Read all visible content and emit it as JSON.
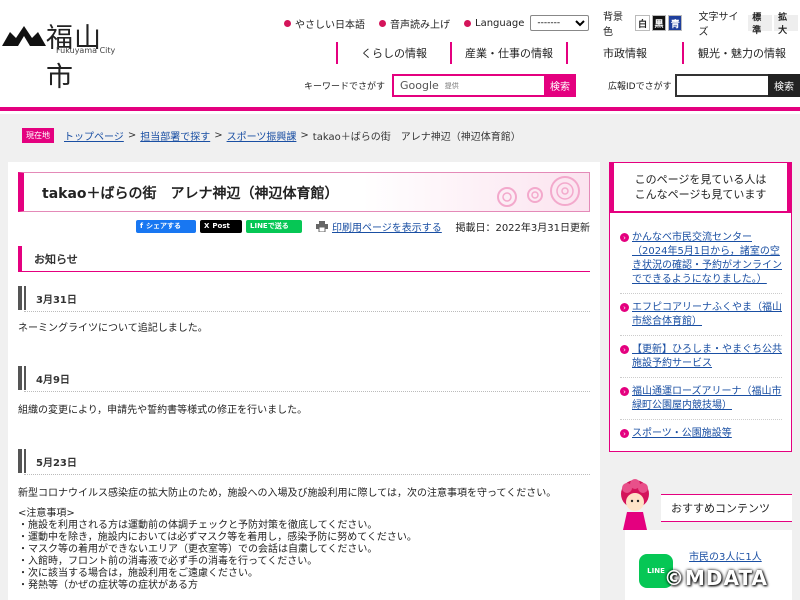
{
  "logo": {
    "kanji": "福山市",
    "english": "Fukuyama City"
  },
  "utility": {
    "easy_japanese": "やさしい日本語",
    "read_aloud": "音声読み上げ",
    "language_label": "Language",
    "language_value": "-------",
    "bg_label": "背景色",
    "bg_white": "白",
    "bg_black": "黒",
    "bg_blue": "青",
    "font_label": "文字サイズ",
    "font_standard": "標準",
    "font_large": "拡大"
  },
  "gnav": [
    {
      "label": "くらしの情報"
    },
    {
      "label": "産業・仕事の情報"
    },
    {
      "label": "市政情報"
    },
    {
      "label": "観光・魅力の情報"
    }
  ],
  "search": {
    "keyword_label": "キーワードでさがす",
    "google": "Google",
    "provided": "提供",
    "keyword_button": "検索",
    "id_label": "広報IDでさがす",
    "id_button": "検索"
  },
  "breadcrumb": {
    "badge": "現在地",
    "top": "トップページ",
    "dept": "担当部署で探す",
    "section": "スポーツ振興課",
    "current": "takao＋ばらの街　アレナ神辺（神辺体育館）"
  },
  "main": {
    "title": "takao＋ばらの街　アレナ神辺（神辺体育館）",
    "share_facebook": "シェアする",
    "share_x": "Post",
    "share_line": "LINEで送る",
    "print_link": "印刷用ページを表示する",
    "posted": "掲載日：2022年3月31日更新",
    "notice_heading": "お知らせ",
    "updates": [
      {
        "date": "3月31日",
        "text": "ネーミングライツについて追記しました。"
      },
      {
        "date": "4月9日",
        "text": "組織の変更により，申請先や誓約書等様式の修正を行いました。"
      },
      {
        "date": "5月23日",
        "text": "新型コロナウイルス感染症の拡大防止のため，施設への入場及び施設利用に際しては，次の注意事項を守ってください。"
      }
    ],
    "notes_heading": "<注意事項>",
    "notes": [
      "・施設を利用される方は運動前の体調チェックと予防対策を徹底してください。",
      "・運動中を除き，施設内においては必ずマスク等を着用し，感染予防に努めてください。",
      "・マスク等の着用ができないエリア（更衣室等）での会話は自粛してください。",
      "・入館時，フロント前の消毒液で必ず手の消毒を行ってください。",
      "・次に該当する場合は，施設利用をご遠慮ください。",
      "・発熱等（かぜの症状等の症状がある方"
    ]
  },
  "side": {
    "heading_line1": "このページを見ている人は",
    "heading_line2": "こんなページも見ています",
    "items": [
      {
        "text": "かんなべ市民交流センター（2024年5月1日から，諸室の空き状況の確認・予約がオンラインでできるようになりました。）"
      },
      {
        "text": "エフピコアリーナふくやま（福山市総合体育館）"
      },
      {
        "text": "【更新】ひろしま・やまぐち公共施設予約サービス"
      },
      {
        "text": "福山通運ローズアリーナ（福山市緑町公園屋内競技場）"
      },
      {
        "text": "スポーツ・公園施設等"
      }
    ]
  },
  "recommend": {
    "title": "おすすめコンテンツ",
    "line_icon": "LINE",
    "link": "市民の3人に1人"
  },
  "watermark": "©MDATA",
  "colors": {
    "accent": "#e4007f",
    "link": "#1a4fa3"
  }
}
